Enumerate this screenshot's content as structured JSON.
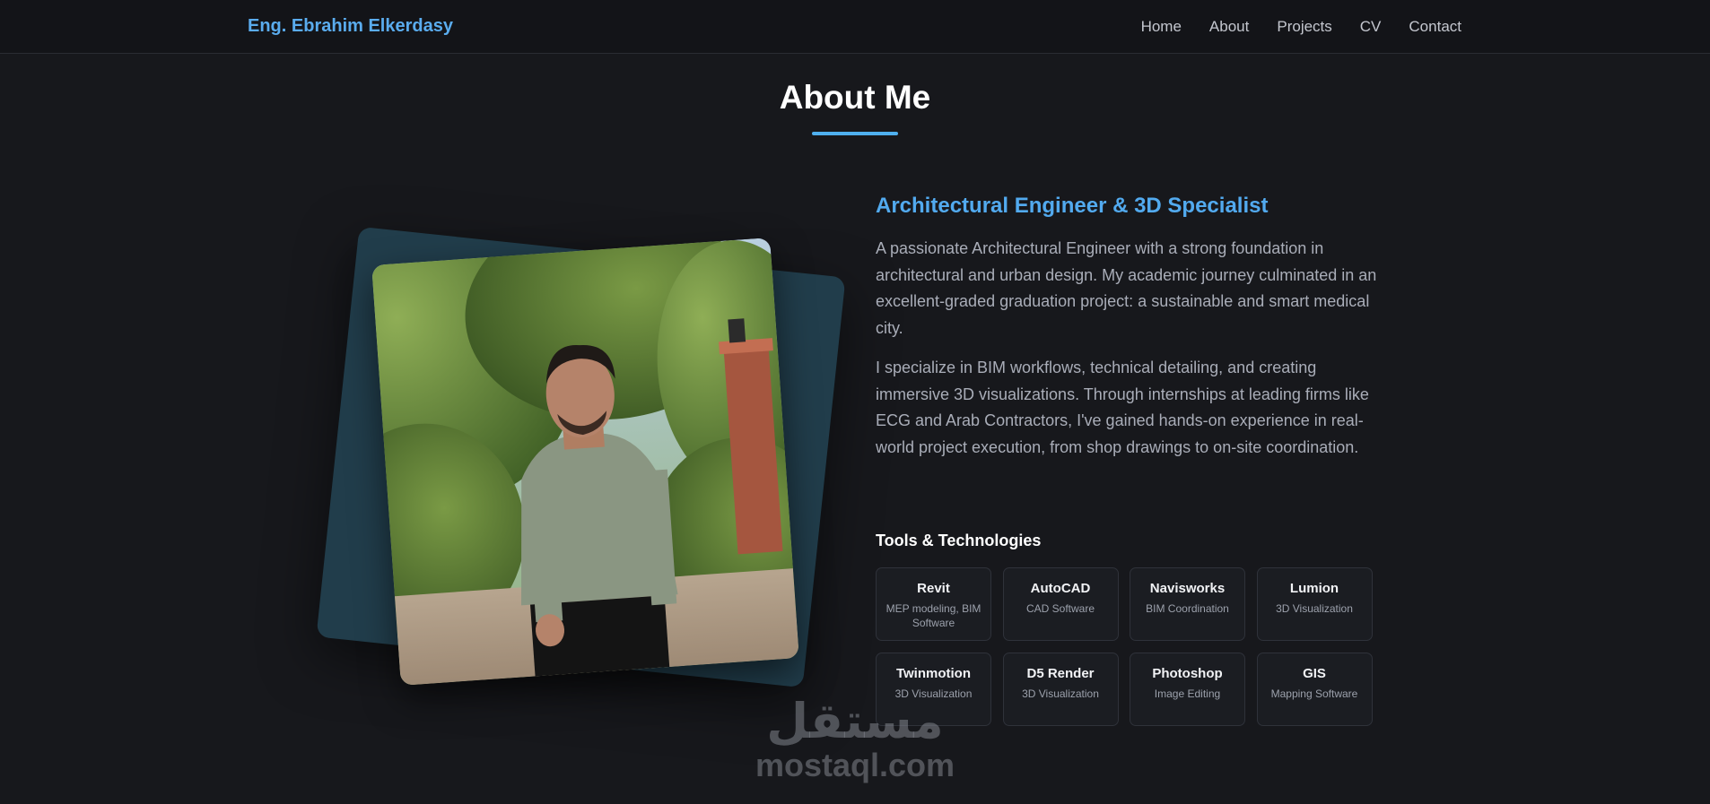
{
  "navbar": {
    "brand": "Eng. Ebrahim Elkerdasy",
    "links": [
      "Home",
      "About",
      "Projects",
      "CV",
      "Contact"
    ]
  },
  "about": {
    "title": "About Me",
    "subtitle": "Architectural Engineer & 3D Specialist",
    "paragraphs": [
      "A passionate Architectural Engineer with a strong foundation in architectural and urban design. My academic journey culminated in an excellent-graded graduation project: a sustainable and smart medical city.",
      "I specialize in BIM workflows, technical detailing, and creating immersive 3D visualizations. Through internships at leading firms like ECG and Arab Contractors, I've gained hands-on experience in real-world project execution, from shop drawings to on-site coordination."
    ],
    "tools_heading": "Tools & Technologies",
    "tools": [
      {
        "name": "Revit",
        "desc": "MEP modeling, BIM Software"
      },
      {
        "name": "AutoCAD",
        "desc": "CAD Software"
      },
      {
        "name": "Navisworks",
        "desc": "BIM Coordination"
      },
      {
        "name": "Lumion",
        "desc": "3D Visualization"
      },
      {
        "name": "Twinmotion",
        "desc": "3D Visualization"
      },
      {
        "name": "D5 Render",
        "desc": "3D Visualization"
      },
      {
        "name": "Photoshop",
        "desc": "Image Editing"
      },
      {
        "name": "GIS",
        "desc": "Mapping Software"
      }
    ]
  },
  "watermark": {
    "arabic": "مستقل",
    "latin": "mostaql.com"
  },
  "colors": {
    "background": "#17181c",
    "accent": "#52aaef",
    "photo_back": "#213d4b"
  }
}
